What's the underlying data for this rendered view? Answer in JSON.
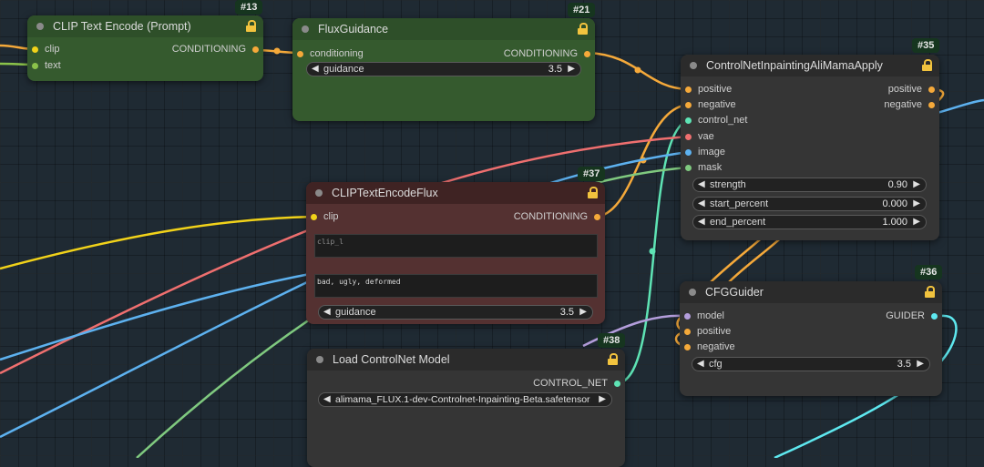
{
  "colors": {
    "conditioning": "#f5a93a",
    "clip": "#f1d21a",
    "vae": "#ef6f6f",
    "image": "#5db1ef",
    "mask": "#7fc97f",
    "control_net": "#5ee3b4",
    "model": "#b39ddb",
    "guider": "#5ee8ef",
    "text": "#8bc34a"
  },
  "nodes": {
    "clip_text_encode": {
      "badge": "#13",
      "title": "CLIP Text Encode (Prompt)",
      "inputs": [
        "clip",
        "text"
      ],
      "output": "CONDITIONING"
    },
    "flux_guidance": {
      "badge": "#21",
      "title": "FluxGuidance",
      "input": "conditioning",
      "output": "CONDITIONING",
      "widget": {
        "label": "guidance",
        "value": "3.5"
      }
    },
    "controlnet_apply": {
      "badge": "#35",
      "title": "ControlNetInpaintingAliMamaApply",
      "inputs": [
        "positive",
        "negative",
        "control_net",
        "vae",
        "image",
        "mask"
      ],
      "outputs": [
        "positive",
        "negative"
      ],
      "widgets": [
        {
          "label": "strength",
          "value": "0.90"
        },
        {
          "label": "start_percent",
          "value": "0.000"
        },
        {
          "label": "end_percent",
          "value": "1.000"
        }
      ]
    },
    "clip_text_encode_flux": {
      "badge": "#37",
      "title": "CLIPTextEncodeFlux",
      "input": "clip",
      "output": "CONDITIONING",
      "clip_l_placeholder": "clip_l",
      "t5_text": "bad, ugly, deformed",
      "widget": {
        "label": "guidance",
        "value": "3.5"
      }
    },
    "cfg_guider": {
      "badge": "#36",
      "title": "CFGGuider",
      "inputs": [
        "model",
        "positive",
        "negative"
      ],
      "output": "GUIDER",
      "widget": {
        "label": "cfg",
        "value": "3.5"
      }
    },
    "load_controlnet": {
      "badge": "#38",
      "title": "Load ControlNet Model",
      "output": "CONTROL_NET",
      "combo_value": "alimama_FLUX.1-dev-Controlnet-Inpainting-Beta.safetensors"
    }
  }
}
